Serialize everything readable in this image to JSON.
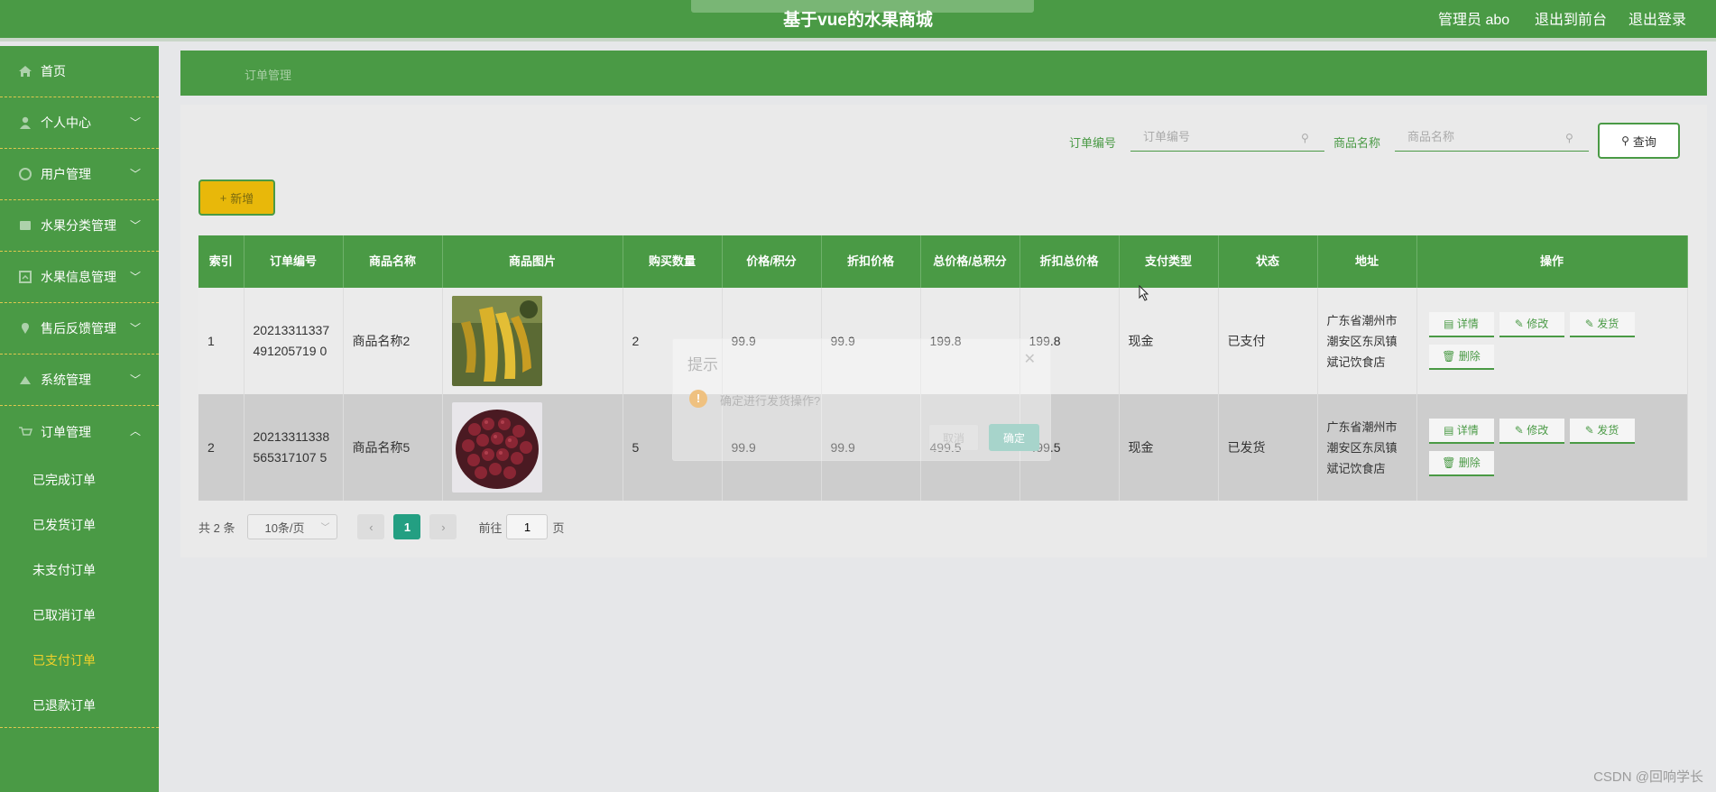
{
  "header": {
    "title": "基于vue的水果商城",
    "user": "管理员 abo",
    "nav": [
      "退出到前台",
      "退出登录"
    ]
  },
  "sidebar": {
    "items": [
      {
        "label": "首页",
        "icon": "home-icon",
        "chevron": ""
      },
      {
        "label": "个人中心",
        "icon": "user-icon",
        "chevron": "﹀"
      },
      {
        "label": "用户管理",
        "icon": "users-icon",
        "chevron": "﹀"
      },
      {
        "label": "水果分类管理",
        "icon": "category-icon",
        "chevron": "﹀"
      },
      {
        "label": "水果信息管理",
        "icon": "info-icon",
        "chevron": "﹀"
      },
      {
        "label": "售后反馈管理",
        "icon": "feedback-icon",
        "chevron": "﹀"
      },
      {
        "label": "系统管理",
        "icon": "system-icon",
        "chevron": "﹀"
      },
      {
        "label": "订单管理",
        "icon": "order-icon",
        "chevron": "︿"
      }
    ],
    "sub_items": [
      "已完成订单",
      "已发货订单",
      "未支付订单",
      "已取消订单",
      "已支付订单",
      "已退款订单"
    ],
    "active_sub": "已支付订单"
  },
  "breadcrumb": "订单管理",
  "search": {
    "order_label": "订单编号",
    "order_placeholder": "订单编号",
    "product_label": "商品名称",
    "product_placeholder": "商品名称",
    "query_button": "查询"
  },
  "add_button": "新增",
  "table": {
    "headers": [
      "索引",
      "订单编号",
      "商品名称",
      "商品图片",
      "购买数量",
      "价格/积分",
      "折扣价格",
      "总价格/总积分",
      "折扣总价格",
      "支付类型",
      "状态",
      "地址",
      "操作"
    ],
    "rows": [
      {
        "index": "1",
        "order_no": "20213311337491205719 0",
        "product": "商品名称2",
        "qty": "2",
        "price": "99.9",
        "discount_price": "99.9",
        "total": "199.8",
        "discount_total": "199.8",
        "pay_type": "现金",
        "status": "已支付",
        "address": "广东省潮州市潮安区东凤镇斌记饮食店"
      },
      {
        "index": "2",
        "order_no": "20213311338565317107 5",
        "product": "商品名称5",
        "qty": "5",
        "price": "99.9",
        "discount_price": "99.9",
        "total": "499.5",
        "discount_total": "499.5",
        "pay_type": "现金",
        "status": "已发货",
        "address": "广东省潮州市潮安区东凤镇斌记饮食店"
      }
    ],
    "actions": [
      "详情",
      "修改",
      "发货",
      "删除"
    ]
  },
  "pagination": {
    "total": "共 2 条",
    "page_size": "10条/页",
    "current": "1",
    "goto_prefix": "前往",
    "goto_value": "1",
    "goto_suffix": "页"
  },
  "dialog": {
    "title": "提示",
    "message": "确定进行发货操作?",
    "cancel": "取消",
    "confirm": "确定"
  },
  "watermark": "CSDN @回响学长",
  "colors": {
    "primary": "#4a9a45",
    "accent": "#f2d12a",
    "page_active": "#239f82"
  }
}
